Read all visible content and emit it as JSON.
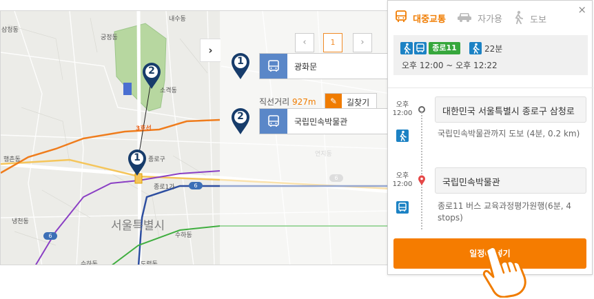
{
  "map": {
    "district_labels": [
      "삼청동",
      "궁정동",
      "소격동",
      "행촌동",
      "종로구",
      "종로1가",
      "내수동",
      "수하동",
      "냉천동",
      "수하동",
      "서울특별시",
      "도렴동",
      "연지동"
    ],
    "line3_tag": "3호선",
    "line6_tag": "6",
    "panel_toggle": "›",
    "pager": {
      "prev": "‹",
      "page": "1",
      "next": "›"
    },
    "pins": [
      "1",
      "2"
    ]
  },
  "results": [
    {
      "index": "1",
      "name": "광화문"
    },
    {
      "index": "2",
      "name": "국립민속박물관"
    }
  ],
  "distance": {
    "label": "직선거리",
    "value": "927m"
  },
  "route_button": {
    "label": "길찾기"
  },
  "side": {
    "close": "×",
    "tabs": [
      {
        "label": "대중교통",
        "icon": "bus-icon",
        "active": true
      },
      {
        "label": "자가용",
        "icon": "car-icon",
        "active": false
      },
      {
        "label": "도보",
        "icon": "walk-icon",
        "active": false
      }
    ],
    "summary": {
      "line_name": "종로11",
      "duration": "22분",
      "time_range": "오후 12:00 ~ 오후 12:22"
    },
    "steps": [
      {
        "ampm": "오후",
        "time": "12:00",
        "place": "대한민국 서울특별시 종로구 삼청로",
        "desc": "국립민속박물관까지 도보 (4분, 0.2 km)"
      },
      {
        "ampm": "오후",
        "time": "12:00",
        "place": "국립민속박물관",
        "desc": "종로11 버스 교육과정평가원행(6분, 4 stops)"
      }
    ],
    "cta": "일정에 넣기"
  },
  "colors": {
    "accent": "#f57c00",
    "transit_blue": "#1c82c4",
    "line_green": "#36a73c",
    "pin_navy": "#173c6b",
    "result_blue": "#5a87c8"
  }
}
